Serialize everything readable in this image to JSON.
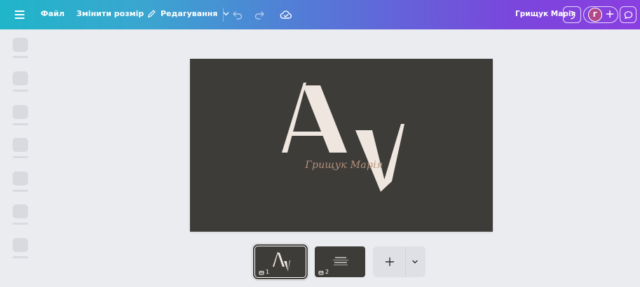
{
  "topbar": {
    "menu_icon": "hamburger-icon",
    "file_label": "Файл",
    "resize_label": "Змінити розмір",
    "edit_label": "Редагування",
    "edit_icon": "pencil-icon",
    "undo_icon": "undo-icon",
    "redo_icon": "redo-icon",
    "save_status_icon": "cloud-check-icon",
    "user_name": "Грищук Марія",
    "theme_icon": "moon-icon",
    "avatar_initial": "Г",
    "add_collaborator_icon": "plus-icon",
    "comment_icon": "comment-icon"
  },
  "design": {
    "monogram_letters": "Av",
    "signature_text": "Грищук Марія",
    "background_color": "#3e3c39",
    "letter_color": "#efe7df",
    "signature_color": "#b7917a"
  },
  "pages": [
    {
      "number": "1",
      "selected": true
    },
    {
      "number": "2",
      "selected": false
    }
  ],
  "add_page": {
    "plus_icon": "plus-icon",
    "chevron_icon": "chevron-down-icon"
  },
  "colors": {
    "gradient_start": "#1fb5c9",
    "gradient_end": "#8a3fe0",
    "workspace": "#ebecf0",
    "avatar": "#b24a8a"
  }
}
